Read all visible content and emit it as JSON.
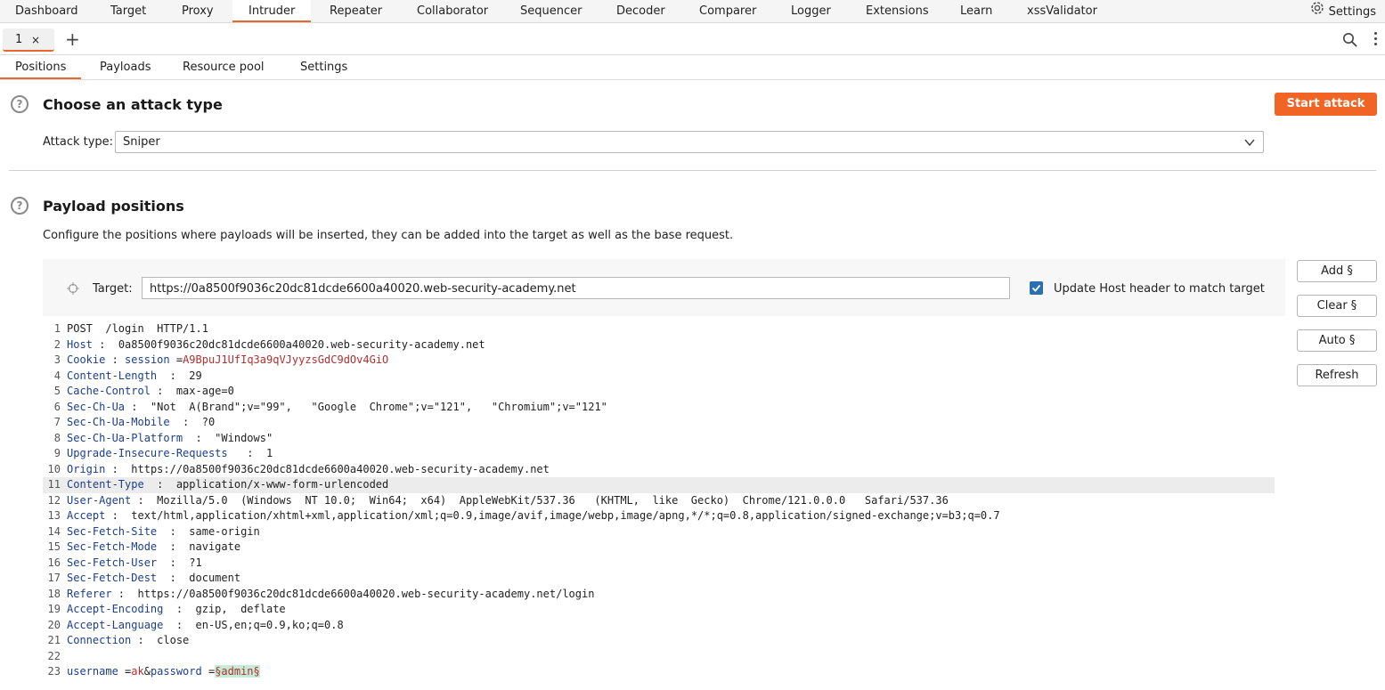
{
  "topnav": {
    "tabs": [
      "Dashboard",
      "Target",
      "Proxy",
      "Intruder",
      "Repeater",
      "Collaborator",
      "Sequencer",
      "Decoder",
      "Comparer",
      "Logger",
      "Extensions",
      "Learn",
      "xssValidator"
    ],
    "active": "Intruder",
    "settings_label": "Settings"
  },
  "instance_tab": {
    "label": "1",
    "close": "×",
    "new": "+"
  },
  "subtabs": {
    "tabs": [
      "Positions",
      "Payloads",
      "Resource pool",
      "Settings"
    ],
    "active": "Positions"
  },
  "attack": {
    "title": "Choose an attack type",
    "start_button": "Start attack",
    "type_label": "Attack type:",
    "type_value": "Sniper"
  },
  "positions": {
    "title": "Payload positions",
    "description": "Configure the positions where payloads will be inserted, they can be added into the target as well as the base request.",
    "target_label": "Target:",
    "target_value": "https://0a8500f9036c20dc81dcde6600a40020.web-security-academy.net",
    "update_host_label": "Update Host header to match target",
    "update_host_checked": true,
    "buttons": {
      "add": "Add §",
      "clear": "Clear §",
      "auto": "Auto §",
      "refresh": "Refresh"
    }
  },
  "request": {
    "highlighted_line": 11,
    "lines": [
      {
        "n": "1",
        "request_line": "POST  /login  HTTP/1.1"
      },
      {
        "n": "2",
        "name": "Host",
        "sep": " : ",
        "value": " 0a8500f9036c20dc81dcde6600a40020.web-security-academy.net"
      },
      {
        "n": "3",
        "name": "Cookie",
        "sep": " : ",
        "cookie_name": "session",
        "cookie_eq": " =",
        "cookie_value": "A9BpuJ1UfIq3a9qVJyyzsGdC9dOv4GiO"
      },
      {
        "n": "4",
        "name": "Content-Length",
        "sep": "  : ",
        "value": " 29"
      },
      {
        "n": "5",
        "name": "Cache-Control",
        "sep": " : ",
        "value": " max-age=0"
      },
      {
        "n": "6",
        "name": "Sec-Ch-Ua",
        "sep": " : ",
        "value": " \"Not  A(Brand\";v=\"99\",   \"Google  Chrome\";v=\"121\",   \"Chromium\";v=\"121\""
      },
      {
        "n": "7",
        "name": "Sec-Ch-Ua-Mobile",
        "sep": "  : ",
        "value": " ?0"
      },
      {
        "n": "8",
        "name": "Sec-Ch-Ua-Platform",
        "sep": "  : ",
        "value": " \"Windows\""
      },
      {
        "n": "9",
        "name": "Upgrade-Insecure-Requests",
        "sep": "   : ",
        "value": " 1"
      },
      {
        "n": "10",
        "name": "Origin",
        "sep": " : ",
        "value": " https://0a8500f9036c20dc81dcde6600a40020.web-security-academy.net"
      },
      {
        "n": "11",
        "name": "Content-Type",
        "sep": "  : ",
        "value": " application/x-www-form-urlencoded"
      },
      {
        "n": "12",
        "name": "User-Agent",
        "sep": " : ",
        "value": " Mozilla/5.0  (Windows  NT 10.0;  Win64;  x64)  AppleWebKit/537.36   (KHTML,  like  Gecko)  Chrome/121.0.0.0   Safari/537.36"
      },
      {
        "n": "13",
        "name": "Accept",
        "sep": " : ",
        "value": " text/html,application/xhtml+xml,application/xml;q=0.9,image/avif,image/webp,image/apng,*/*;q=0.8,application/signed-exchange;v=b3;q=0.7"
      },
      {
        "n": "14",
        "name": "Sec-Fetch-Site",
        "sep": "  : ",
        "value": " same-origin"
      },
      {
        "n": "15",
        "name": "Sec-Fetch-Mode",
        "sep": "  : ",
        "value": " navigate"
      },
      {
        "n": "16",
        "name": "Sec-Fetch-User",
        "sep": "  : ",
        "value": " ?1"
      },
      {
        "n": "17",
        "name": "Sec-Fetch-Dest",
        "sep": "  : ",
        "value": " document"
      },
      {
        "n": "18",
        "name": "Referer",
        "sep": " : ",
        "value": " https://0a8500f9036c20dc81dcde6600a40020.web-security-academy.net/login"
      },
      {
        "n": "19",
        "name": "Accept-Encoding",
        "sep": "  : ",
        "value": " gzip,  deflate"
      },
      {
        "n": "20",
        "name": "Accept-Language",
        "sep": "  : ",
        "value": " en-US,en;q=0.9,ko;q=0.8"
      },
      {
        "n": "21",
        "name": "Connection",
        "sep": " : ",
        "value": " close"
      },
      {
        "n": "22"
      },
      {
        "n": "23",
        "body": {
          "p1": "username",
          "eq1": " =",
          "v1": "ak",
          "amp": "&",
          "p2": "password",
          "eq2": " =",
          "marked": "§admin§"
        }
      }
    ]
  },
  "colors": {
    "accent": "#e8662f",
    "start_button": "#f06425",
    "checkbox": "#2a6fb0",
    "header_name": "#1b3f8a",
    "value_red": "#b03030",
    "payload_marker_bg": "#c4ecd6"
  }
}
